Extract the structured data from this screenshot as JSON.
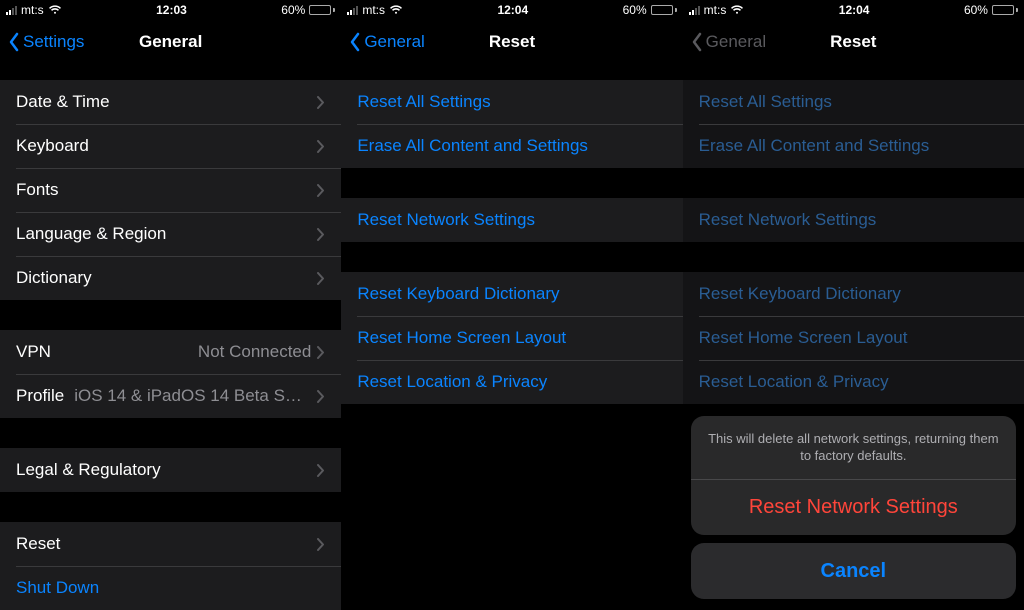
{
  "status": {
    "carrier": "mt:s",
    "battery_pct": "60%"
  },
  "screen1": {
    "time": "12:03",
    "back_label": "Settings",
    "title": "General",
    "groups": [
      {
        "rows": [
          {
            "label": "Date & Time"
          },
          {
            "label": "Keyboard"
          },
          {
            "label": "Fonts"
          },
          {
            "label": "Language & Region"
          },
          {
            "label": "Dictionary"
          }
        ]
      },
      {
        "rows": [
          {
            "label": "VPN",
            "value": "Not Connected"
          },
          {
            "label": "Profile",
            "value": "iOS 14 & iPadOS 14 Beta Softwar…"
          }
        ]
      },
      {
        "rows": [
          {
            "label": "Legal & Regulatory"
          }
        ]
      },
      {
        "rows": [
          {
            "label": "Reset"
          },
          {
            "label": "Shut Down"
          }
        ]
      }
    ]
  },
  "screen2": {
    "time": "12:04",
    "back_label": "General",
    "title": "Reset",
    "groups": [
      {
        "rows": [
          {
            "label": "Reset All Settings"
          },
          {
            "label": "Erase All Content and Settings"
          }
        ]
      },
      {
        "rows": [
          {
            "label": "Reset Network Settings"
          }
        ]
      },
      {
        "rows": [
          {
            "label": "Reset Keyboard Dictionary"
          },
          {
            "label": "Reset Home Screen Layout"
          },
          {
            "label": "Reset Location & Privacy"
          }
        ]
      }
    ]
  },
  "screen3": {
    "time": "12:04",
    "back_label": "General",
    "title": "Reset",
    "sheet": {
      "message": "This will delete all network settings, returning them to factory defaults.",
      "destructive_label": "Reset Network Settings",
      "cancel_label": "Cancel"
    }
  }
}
